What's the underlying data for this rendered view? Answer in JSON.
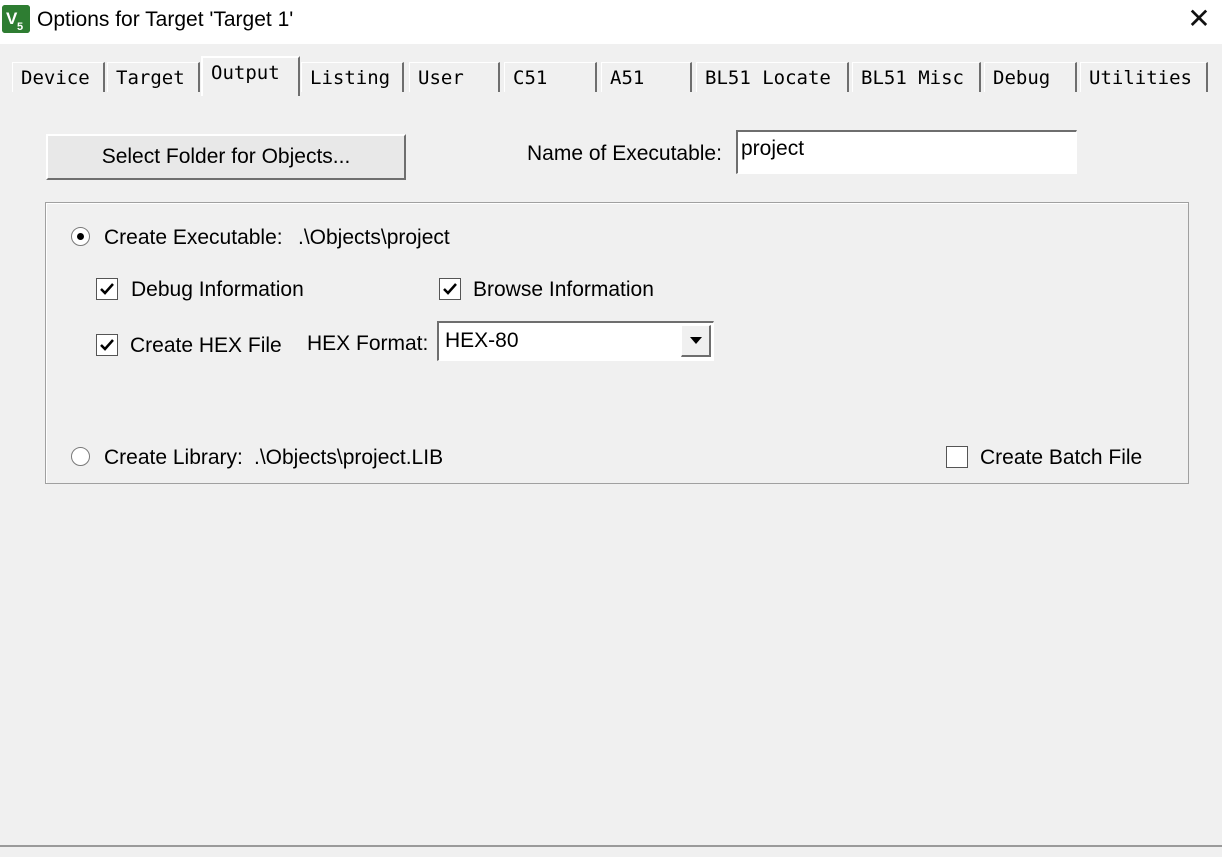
{
  "window": {
    "title": "Options for Target 'Target 1'",
    "app_icon": "uvision-icon",
    "close_glyph": "✕"
  },
  "tabs": [
    {
      "label": "Device",
      "active": false
    },
    {
      "label": "Target",
      "active": false
    },
    {
      "label": "Output",
      "active": true
    },
    {
      "label": "Listing",
      "active": false
    },
    {
      "label": "User",
      "active": false
    },
    {
      "label": "C51",
      "active": false
    },
    {
      "label": "A51",
      "active": false
    },
    {
      "label": "BL51 Locate",
      "active": false
    },
    {
      "label": "BL51 Misc",
      "active": false
    },
    {
      "label": "Debug",
      "active": false
    },
    {
      "label": "Utilities",
      "active": false
    }
  ],
  "output": {
    "select_folder_label": "Select Folder for Objects...",
    "name_of_executable_label": "Name of Executable:",
    "name_of_executable_value": "project",
    "create_executable_label": "Create Executable:",
    "create_executable_path": ".\\Objects\\project",
    "create_executable_selected": true,
    "debug_info_label": "Debug Information",
    "debug_info_checked": true,
    "browse_info_label": "Browse Information",
    "browse_info_checked": true,
    "create_hex_label": "Create HEX File",
    "create_hex_checked": true,
    "hex_format_label": "HEX Format:",
    "hex_format_value": "HEX-80",
    "create_library_label": "Create Library:",
    "create_library_path": ".\\Objects\\project.LIB",
    "create_library_selected": false,
    "create_batch_label": "Create Batch File",
    "create_batch_checked": false
  }
}
